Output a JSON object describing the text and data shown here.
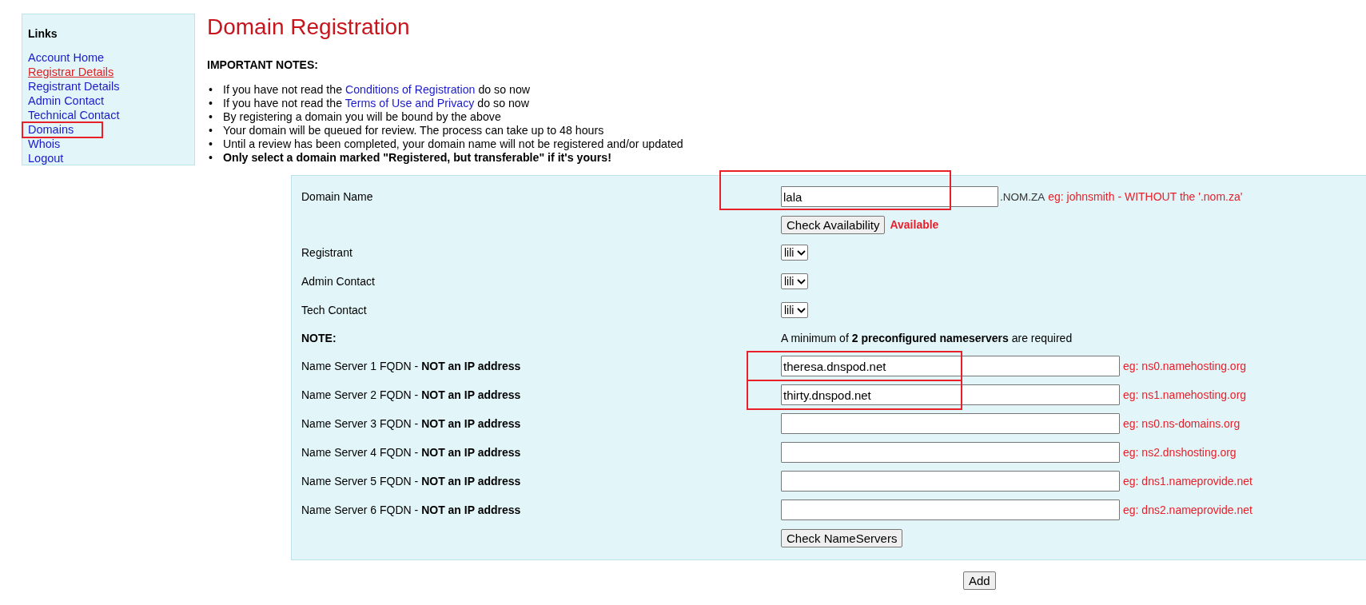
{
  "sidebar": {
    "title": "Links",
    "items": [
      {
        "label": "Account Home",
        "active": false,
        "annotated": false
      },
      {
        "label": "Registrar Details",
        "active": true,
        "annotated": false
      },
      {
        "label": "Registrant Details",
        "active": false,
        "annotated": false
      },
      {
        "label": "Admin Contact",
        "active": false,
        "annotated": false
      },
      {
        "label": "Technical Contact",
        "active": false,
        "annotated": false
      },
      {
        "label": "Domains",
        "active": false,
        "annotated": true
      },
      {
        "label": "Whois",
        "active": false,
        "annotated": false
      },
      {
        "label": "Logout",
        "active": false,
        "annotated": false
      }
    ]
  },
  "page_title": "Domain Registration",
  "notes_heading": "IMPORTANT NOTES:",
  "notes": [
    {
      "marker": "•",
      "before": "If you have not read the ",
      "link": "Conditions of Registration",
      "after": " do so now",
      "bold": false
    },
    {
      "marker": "•",
      "before": "If you have not read the ",
      "link": "Terms of Use and Privacy",
      "after": " do so now",
      "bold": false
    },
    {
      "marker": "•",
      "before": "By registering a domain you will be bound by the above",
      "bold": false
    },
    {
      "marker": "•",
      "before": "Your domain will be queued for review. The process can take up to 48 hours",
      "bold": false
    },
    {
      "marker": "•",
      "before": "Until a review has been completed, your domain name will not be registered and/or updated",
      "bold": false
    },
    {
      "marker": "•",
      "before": "Only select a domain marked \"Registered, but transferable\" if it's yours!",
      "bold": true
    }
  ],
  "form": {
    "domain_name": {
      "label": "Domain Name",
      "value": "lala",
      "suffix": ".NOM.ZA",
      "hint": "eg: johnsmith - WITHOUT the '.nom.za'",
      "annotated": true
    },
    "check_availability": {
      "button": "Check Availability",
      "status": "Available"
    },
    "contacts": [
      {
        "label": "Registrant",
        "value": "lili"
      },
      {
        "label": "Admin Contact",
        "value": "lili"
      },
      {
        "label": "Tech Contact",
        "value": "lili"
      }
    ],
    "note": {
      "label": "NOTE:",
      "text": "A minimum of **2 preconfigured nameservers** are required"
    },
    "nameservers": [
      {
        "label": "Name Server 1 FQDN - **NOT an IP address**",
        "value": "theresa.dnspod.net",
        "hint": "eg: ns0.namehosting.org",
        "annotated": true
      },
      {
        "label": "Name Server 2 FQDN - **NOT an IP address**",
        "value": "thirty.dnspod.net",
        "hint": "eg: ns1.namehosting.org",
        "annotated": true
      },
      {
        "label": "Name Server 3 FQDN - **NOT an IP address**",
        "hint": "eg: ns0.ns-domains.org",
        "annotated": false
      },
      {
        "label": "Name Server 4 FQDN - **NOT an IP address**",
        "hint": "eg: ns2.dnshosting.org",
        "annotated": false
      },
      {
        "label": "Name Server 5 FQDN - **NOT an IP address**",
        "hint": "eg: dns1.nameprovide.net",
        "annotated": false
      },
      {
        "label": "Name Server 6 FQDN - **NOT an IP address**",
        "hint": "eg: dns2.nameprovide.net",
        "annotated": false
      }
    ],
    "check_nameservers": "Check NameServers"
  },
  "add_button": "Add"
}
